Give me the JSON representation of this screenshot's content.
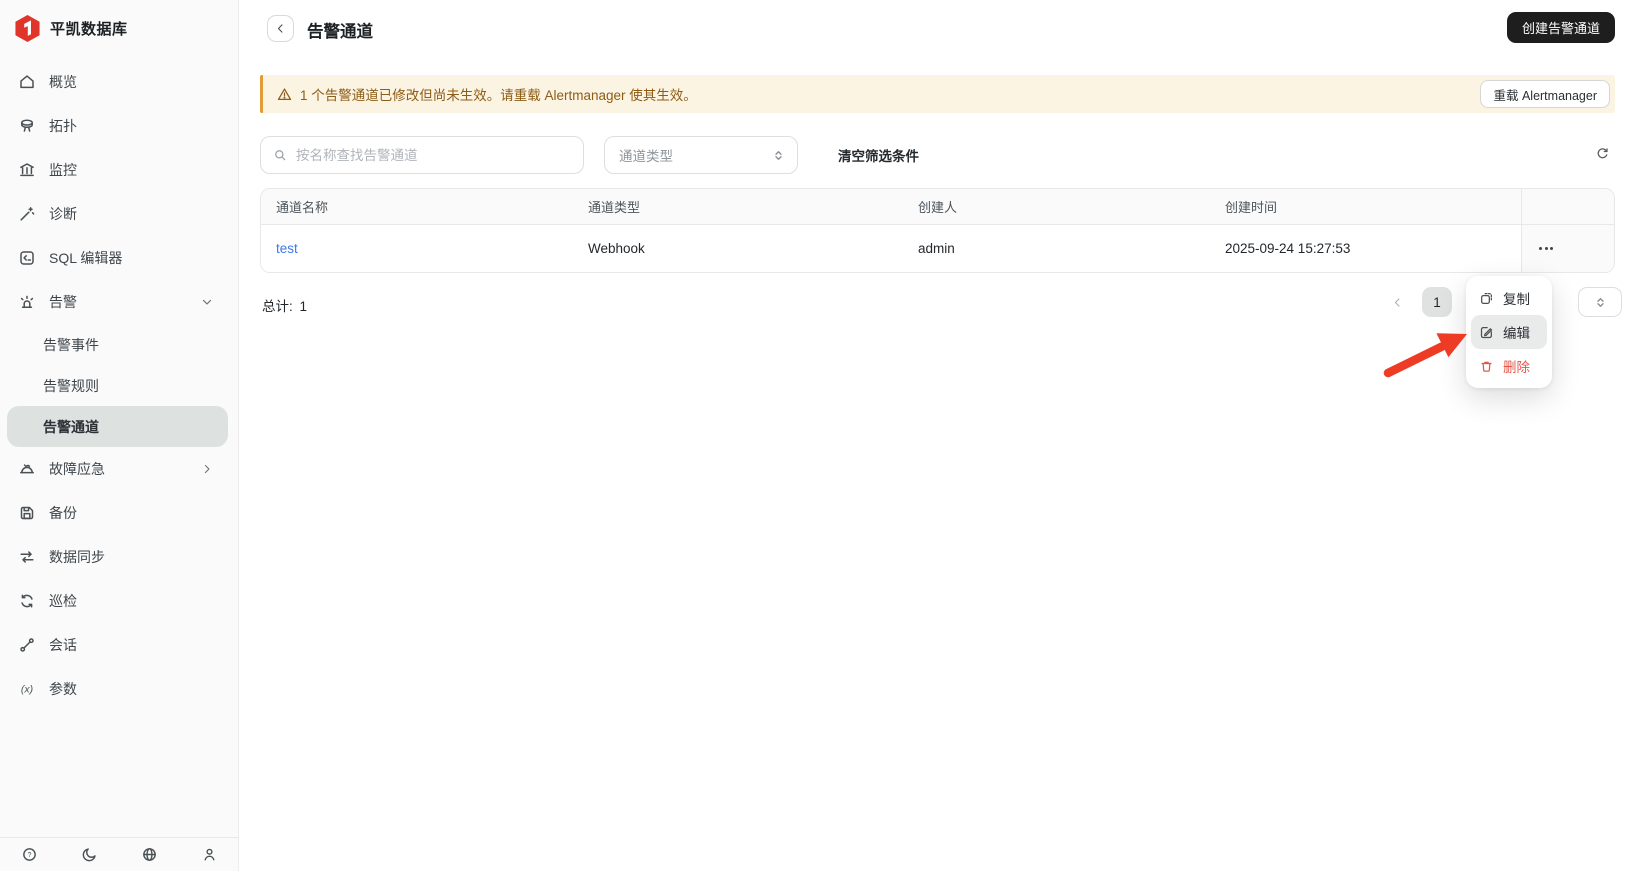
{
  "app": {
    "logo_text": "平凯数据库",
    "logo_icon": "red-hexagon-brand-mark",
    "brand_red": "#e0352b"
  },
  "sidebar": {
    "items": [
      {
        "label": "概览",
        "icon": "home-icon"
      },
      {
        "label": "拓扑",
        "icon": "topology-icon"
      },
      {
        "label": "监控",
        "icon": "monitoring-icon"
      },
      {
        "label": "诊断",
        "icon": "diagnosis-wand-icon"
      },
      {
        "label": "SQL 编辑器",
        "icon": "sql-editor-icon"
      },
      {
        "label": "告警",
        "icon": "alert-icon",
        "state": "expanded"
      },
      {
        "label": "故障应急",
        "icon": "emergency-icon",
        "state": "collapsed"
      },
      {
        "label": "备份",
        "icon": "backup-icon"
      },
      {
        "label": "数据同步",
        "icon": "data-sync-icon"
      },
      {
        "label": "巡检",
        "icon": "inspection-icon"
      },
      {
        "label": "会话",
        "icon": "session-icon"
      },
      {
        "label": "参数",
        "icon": "parameters-icon"
      }
    ],
    "alert_sub_items": [
      {
        "label": "告警事件",
        "active": false
      },
      {
        "label": "告警规则",
        "active": false
      },
      {
        "label": "告警通道",
        "active": true
      }
    ],
    "footer_icons": [
      "help-icon",
      "theme-moon-icon",
      "language-globe-icon",
      "user-icon"
    ]
  },
  "header": {
    "title": "告警通道",
    "create_button": "创建告警通道"
  },
  "banner": {
    "message": "1 个告警通道已修改但尚未生效。请重载 Alertmanager 使其生效。",
    "reload_button": "重载 Alertmanager",
    "bg": "#fcf4e3",
    "border": "#e49b33",
    "text_color": "#8d5c16"
  },
  "filters": {
    "search_placeholder": "按名称查找告警通道",
    "type_select_placeholder": "通道类型",
    "clear_label": "清空筛选条件"
  },
  "table": {
    "columns": [
      "通道名称",
      "通道类型",
      "创建人",
      "创建时间"
    ],
    "rows": [
      {
        "name": "test",
        "type": "Webhook",
        "creator": "admin",
        "created_at": "2025-09-24 15:27:53"
      }
    ],
    "link_color": "#3a7af0"
  },
  "pagination": {
    "total_label": "总计:",
    "total_value": "1",
    "current_page": "1"
  },
  "context_menu": {
    "copy": "复制",
    "edit": "编辑",
    "delete": "删除",
    "highlighted_item": "编辑",
    "danger_color": "#e4564a"
  },
  "annotation": {
    "arrow_color": "#ee3b26",
    "arrow_points_to": "编辑"
  }
}
